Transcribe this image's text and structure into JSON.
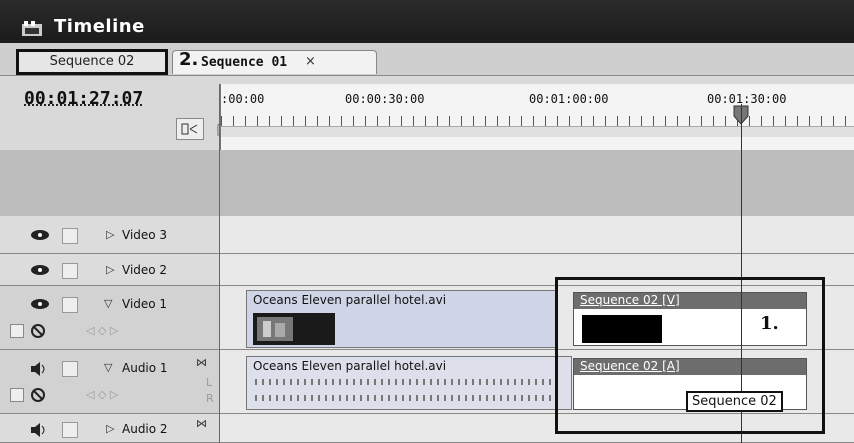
{
  "window": {
    "title": "Timeline"
  },
  "tabs": [
    {
      "label": "Sequence 02"
    },
    {
      "callout_number": "2.",
      "label": "Sequence 01",
      "close": "×"
    }
  ],
  "header": {
    "timecode": "00:01:27:07",
    "ruler_labels": [
      ":00:00",
      "00:00:30:00",
      "00:01:00:00",
      "00:01:30:00"
    ]
  },
  "tracks": {
    "video3": {
      "name": "Video 3"
    },
    "video2": {
      "name": "Video 2"
    },
    "video1": {
      "name": "Video 1",
      "clip_title": "Oceans Eleven parallel hotel.avi",
      "nested_clip": "Sequence 02 [V]"
    },
    "audio1": {
      "name": "Audio 1",
      "channel_l": "L",
      "channel_r": "R",
      "clip_title": "Oceans Eleven parallel hotel.avi",
      "nested_clip": "Sequence 02 [A]"
    },
    "audio2": {
      "name": "Audio 2"
    }
  },
  "annotations": {
    "callout1": "1.",
    "tooltip": "Sequence 02"
  },
  "icons": [
    "timeline-panel-icon",
    "snap-icon",
    "marker-icon",
    "eye-icon",
    "speaker-icon",
    "expand-triangle-icon",
    "collapse-triangle-icon",
    "lock-icon",
    "keyframe-nav-icon",
    "playhead-icon"
  ]
}
